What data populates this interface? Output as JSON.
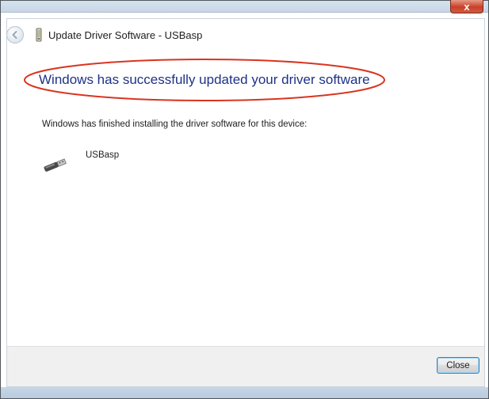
{
  "window": {
    "title": "Update Driver Software - USBasp",
    "close_glyph": "x"
  },
  "back_icon": "back-arrow-icon",
  "main": {
    "heading": "Windows has successfully updated your driver software",
    "subtitle": "Windows has finished installing the driver software for this device:",
    "device_name": "USBasp",
    "device_icon": "usb-plug-icon"
  },
  "footer": {
    "close_label": "Close"
  },
  "colors": {
    "heading": "#1e3287",
    "annotation_ellipse": "#d9341f",
    "footer_bg": "#f0f0f0"
  }
}
